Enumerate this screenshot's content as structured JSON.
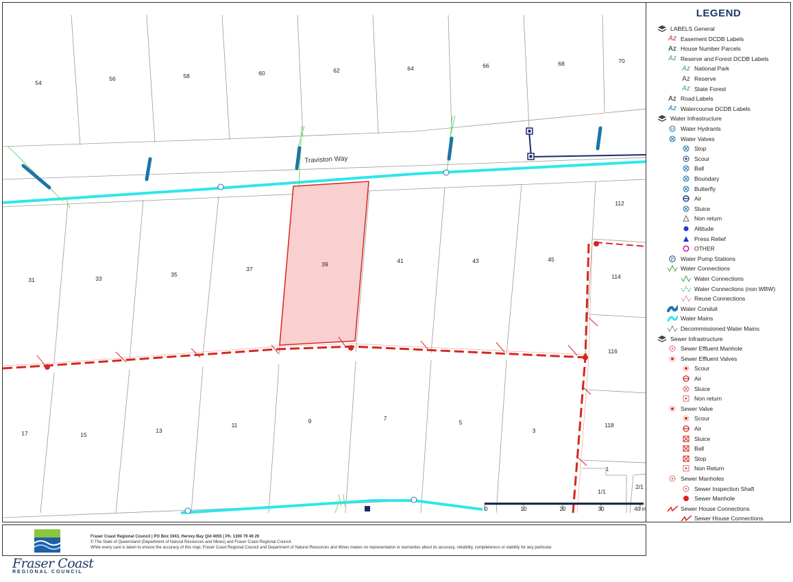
{
  "map": {
    "road_label": "Traviston Way",
    "lot_numbers": {
      "top_row": [
        "54",
        "56",
        "58",
        "60",
        "62",
        "64",
        "66",
        "68",
        "70"
      ],
      "middle_row": [
        "31",
        "33",
        "35",
        "37",
        "39",
        "41",
        "43",
        "45"
      ],
      "bottom_row": [
        "17",
        "15",
        "13",
        "11",
        "9",
        "7",
        "5",
        "3"
      ],
      "right_column": [
        "112",
        "114",
        "116",
        "118"
      ],
      "units": [
        "1",
        "1/1",
        "2/1"
      ]
    },
    "highlighted_lot": "39",
    "scale_bar": {
      "ticks": [
        "0",
        "10",
        "20",
        "30",
        "40 m"
      ]
    },
    "colors": {
      "water_main": "#2ee6ea",
      "water_conduit": "#1b74a8",
      "sewer_line": "#d6261f",
      "highlight_fill": "#f9cfcf",
      "highlight_stroke": "#d6261f",
      "parcel_line": "#9a9a9a",
      "water_connection": "#6fd66f",
      "pump_line": "#1a2a6c"
    }
  },
  "legend": {
    "title": "LEGEND",
    "items": [
      {
        "label": "LABELS General",
        "icon": "layer-icon",
        "indent": 0
      },
      {
        "label": "Easement DCDB Labels",
        "icon": "az-red",
        "indent": 1
      },
      {
        "label": "House Number Parcels",
        "icon": "az-black",
        "indent": 1
      },
      {
        "label": "Reserve and Forest DCDB Labels",
        "icon": "az-green",
        "indent": 1
      },
      {
        "label": "National Park",
        "icon": "az-green",
        "indent": 2
      },
      {
        "label": "Reserve",
        "icon": "az-gray",
        "indent": 2
      },
      {
        "label": "State Forest",
        "icon": "az-green",
        "indent": 2
      },
      {
        "label": "Road Labels",
        "icon": "az-black",
        "indent": 1
      },
      {
        "label": "Watercourse DCDB Labels",
        "icon": "az-blue",
        "indent": 1
      },
      {
        "label": "Water Infrastructure",
        "icon": "layer-icon",
        "indent": 0
      },
      {
        "label": "Water Hydrants",
        "icon": "hydrant-icon",
        "indent": 1
      },
      {
        "label": "Water Valves",
        "icon": "valve-icon",
        "indent": 1
      },
      {
        "label": "Stop",
        "icon": "valve-icon",
        "indent": 2
      },
      {
        "label": "Scour",
        "icon": "scour-icon",
        "indent": 2
      },
      {
        "label": "Ball",
        "icon": "valve-icon",
        "indent": 2
      },
      {
        "label": "Boundary",
        "icon": "valve-icon",
        "indent": 2
      },
      {
        "label": "Butterfly",
        "icon": "valve-icon",
        "indent": 2
      },
      {
        "label": "Air",
        "icon": "air-icon",
        "indent": 2
      },
      {
        "label": "Sluice",
        "icon": "valve-icon",
        "indent": 2
      },
      {
        "label": "Non return",
        "icon": "triangle-outline-icon",
        "indent": 2
      },
      {
        "label": "Altitude",
        "icon": "blue-dot-icon",
        "indent": 2
      },
      {
        "label": "Press Relief",
        "icon": "triangle-filled-icon",
        "indent": 2
      },
      {
        "label": "OTHER",
        "icon": "magenta-ring-icon",
        "indent": 2
      },
      {
        "label": "Water Pump Stations",
        "icon": "pump-icon",
        "indent": 1
      },
      {
        "label": "Water Connections",
        "icon": "connection-green-icon",
        "indent": 1
      },
      {
        "label": "Water Connections",
        "icon": "connection-green-icon",
        "indent": 2
      },
      {
        "label": "Water Connections (non WBW)",
        "icon": "connection-dashed-icon",
        "indent": 2
      },
      {
        "label": "Reuse Connections",
        "icon": "connection-pink-icon",
        "indent": 2
      },
      {
        "label": "Water Conduit",
        "icon": "conduit-icon",
        "indent": 1
      },
      {
        "label": "Water Mains",
        "icon": "mains-icon",
        "indent": 1
      },
      {
        "label": "Decommissioned Water Mains",
        "icon": "decommissioned-icon",
        "indent": 1
      },
      {
        "label": "Sewer Infrastructure",
        "icon": "layer-icon",
        "indent": 0
      },
      {
        "label": "Sewer Effluent Manhole",
        "icon": "sewer-ring-icon",
        "indent": 1
      },
      {
        "label": "Sewer Effluent Valves",
        "icon": "sewer-dot-icon",
        "indent": 1
      },
      {
        "label": "Scour",
        "icon": "sewer-dot-icon",
        "indent": 2
      },
      {
        "label": "Air",
        "icon": "sewer-air-icon",
        "indent": 2
      },
      {
        "label": "Sluice",
        "icon": "sewer-x-icon",
        "indent": 2
      },
      {
        "label": "Non return",
        "icon": "sewer-square-icon",
        "indent": 2
      },
      {
        "label": "Sewer Valve",
        "icon": "sewer-dot-icon",
        "indent": 1
      },
      {
        "label": "Scour",
        "icon": "sewer-dot-icon",
        "indent": 2
      },
      {
        "label": "Air",
        "icon": "sewer-air-icon",
        "indent": 2
      },
      {
        "label": "Sluice",
        "icon": "sewer-boxx-icon",
        "indent": 2
      },
      {
        "label": "Ball",
        "icon": "sewer-boxx-icon",
        "indent": 2
      },
      {
        "label": "Stop",
        "icon": "sewer-boxx-icon",
        "indent": 2
      },
      {
        "label": "Non Return",
        "icon": "sewer-square-icon",
        "indent": 2
      },
      {
        "label": "Sewer Manholes",
        "icon": "sewer-ring-icon",
        "indent": 1
      },
      {
        "label": "Sewer Inspection Shaft",
        "icon": "sewer-ring-icon",
        "indent": 2
      },
      {
        "label": "Sewer Manhole",
        "icon": "sewer-filled-icon",
        "indent": 2
      },
      {
        "label": "Sewer House Connections",
        "icon": "sewer-connection-icon",
        "indent": 1
      },
      {
        "label": "Sewer House Connections",
        "icon": "sewer-connection-icon",
        "indent": 2
      }
    ]
  },
  "footer": {
    "line1": "Fraser Coast Regional Council | PO Box 1943, Hervey Bay Qld 4655 | Ph. 1300 79 49 29",
    "line2": "© The State of Queensland (Department of Natural Resources and Mines) and Fraser Coast Regional Council.",
    "line3": "While every care is taken to ensure the accuracy of this map, Fraser Coast Regional Council and Department of Natural Resources and Mines makes no representation or warranties about its accuracy, reliability, completeness or stability for any particular",
    "brand_name": "Fraser Coast",
    "brand_sub": "REGIONAL COUNCIL"
  }
}
